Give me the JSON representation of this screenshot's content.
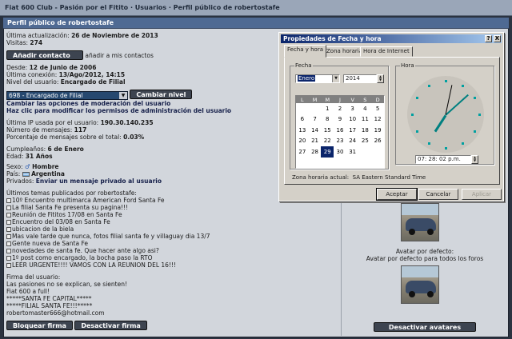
{
  "breadcrumb": [
    "Fiat 600 Club - Pasión por el Fitito",
    "Usuarios",
    "Perfil público de robertostafe"
  ],
  "panel_title": "Perfil público de robertostafe",
  "profile": {
    "last_update_label": "Última actualización:",
    "last_update": "26 de Noviembre de 2013",
    "visits_label": "Visitas:",
    "visits": "274",
    "add_contact_button": "Añadir contacto",
    "add_contact_text": "añadir a mis contactos",
    "since_label": "Desde:",
    "since": "12 de Junio de 2006",
    "last_conn_label": "Última conexión:",
    "last_conn": "13/Ago/2012, 14:15",
    "level_label": "Nivel del usuario:",
    "level": "Encargado de Filial",
    "level_select": "698 - Encargado de Filial",
    "change_level_button": "Cambiar nivel",
    "moderation_link": "Cambiar las opciones de moderación del usuario",
    "admin_link": "Haz clic para modificar los permisos de administración del usuario",
    "last_ip_label": "Última IP usada por el usuario:",
    "last_ip": "190.30.140.235",
    "messages_label": "Número de mensajes:",
    "messages": "117",
    "percent_label": "Porcentaje de mensajes sobre el total:",
    "percent": "0.03%",
    "birthday_label": "Cumpleaños:",
    "birthday": "6 de Enero",
    "age_label": "Edad:",
    "age": "31 Años",
    "sex_label": "Sexo:",
    "sex": "Hombre",
    "country_label": "País:",
    "country": "Argentina",
    "private_label": "Privados:",
    "private_link": "Enviar un mensaje privado al usuario",
    "topics_label": "Últimos temas publicados por robertostafe:",
    "topics": [
      "10º Encuentro multimarca American Ford Santa Fe",
      "La filial Santa Fe presenta su pagina!!!",
      "Reunión de Fititos 17/08 en Santa Fe",
      "Encuentro del 03/08 en Santa Fe",
      "ubicacion de la biela",
      "Mas vale tarde que nunca, fotos filial santa fe y villaguay dia 13/7",
      "Gente nueva de Santa Fe",
      "novedades de santa fe. Que hacer ante algo asi?",
      "1º post como encargado, la bocha paso la RTO",
      "LEER URGENTE!!!! VAMOS CON LA REUNION DEL 16!!!"
    ],
    "signature_label": "Firma del usuario:",
    "signature": [
      "Las pasiones no se explican, se sienten!",
      "Fiat 600 a full!",
      "*****SANTA FE CAPITAL*****",
      "*****FILIAL SANTA FE!!!*****",
      "robertomaster666@hotmail.com"
    ],
    "block_signature_button": "Bloquear firma",
    "disable_signature_button": "Desactivar firma"
  },
  "right": {
    "default_avatar_line1": "Avatar por defecto:",
    "default_avatar_line2": "Avatar por defecto para todos los foros",
    "disable_avatars_button": "Desactivar avatares"
  },
  "dialog": {
    "title": "Propiedades de Fecha y hora",
    "help_btn": "?",
    "close_btn": "X",
    "tabs": [
      "Fecha y hora",
      "Zona horaria",
      "Hora de Internet"
    ],
    "date_group": "Fecha",
    "time_group": "Hora",
    "month": "Enero",
    "year": "2014",
    "weekdays": [
      "L",
      "M",
      "M",
      "J",
      "V",
      "S",
      "D"
    ],
    "weeks": [
      [
        "",
        "",
        "1",
        "2",
        "3",
        "4",
        "5"
      ],
      [
        "6",
        "7",
        "8",
        "9",
        "10",
        "11",
        "12"
      ],
      [
        "13",
        "14",
        "15",
        "16",
        "17",
        "18",
        "19"
      ],
      [
        "20",
        "21",
        "22",
        "23",
        "24",
        "25",
        "26"
      ],
      [
        "27",
        "28",
        "29",
        "30",
        "31",
        "",
        ""
      ]
    ],
    "selected_day": "29",
    "time": "07: 28: 02 p.m.",
    "timezone_label": "Zona horaria actual:",
    "timezone": "SA Eastern Standard Time",
    "ok": "Aceptar",
    "cancel": "Cancelar",
    "apply": "Aplicar"
  }
}
